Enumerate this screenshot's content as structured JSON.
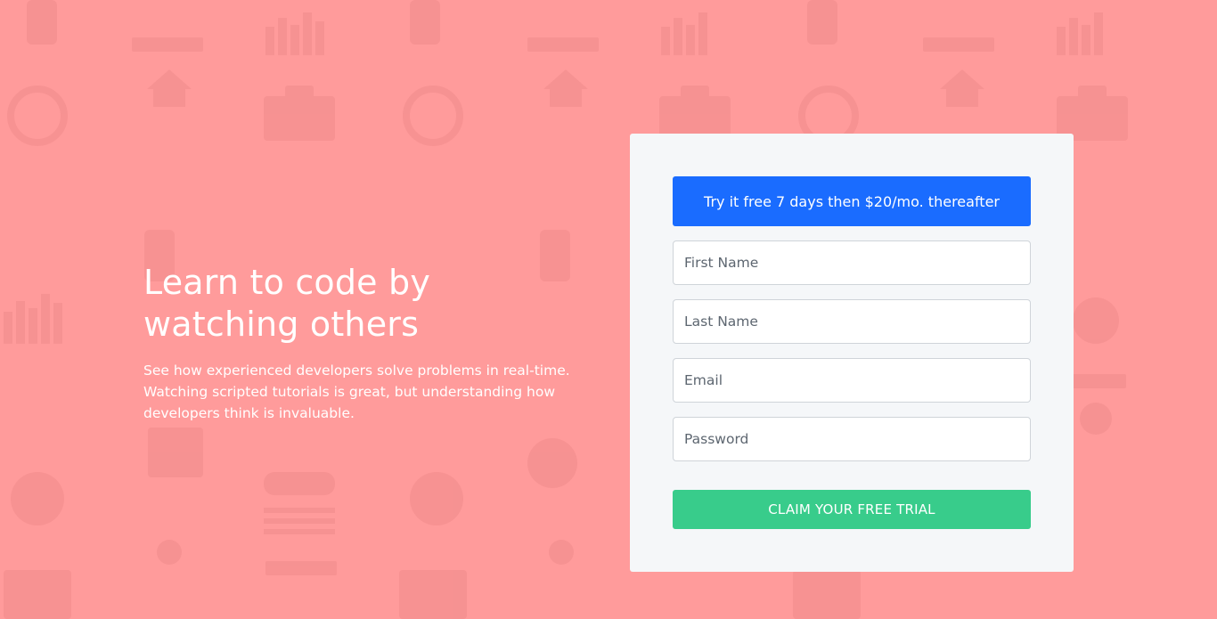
{
  "hero": {
    "title_line1": "Learn to code by",
    "title_line2": "watching others",
    "description": "See how experienced developers solve problems in real-time. Watching scripted tutorials is great, but understanding how developers think is invaluable."
  },
  "signup": {
    "promo_text": "Try it free 7 days then $20/mo. thereafter",
    "fields": {
      "first_name_placeholder": "First Name",
      "last_name_placeholder": "Last Name",
      "email_placeholder": "Email",
      "password_placeholder": "Password"
    },
    "submit_label": "CLAIM YOUR FREE TRIAL"
  },
  "colors": {
    "background": "#ff9b9b",
    "promo": "#1a6cff",
    "cta": "#38cc8b",
    "card": "#f5f7f9"
  }
}
